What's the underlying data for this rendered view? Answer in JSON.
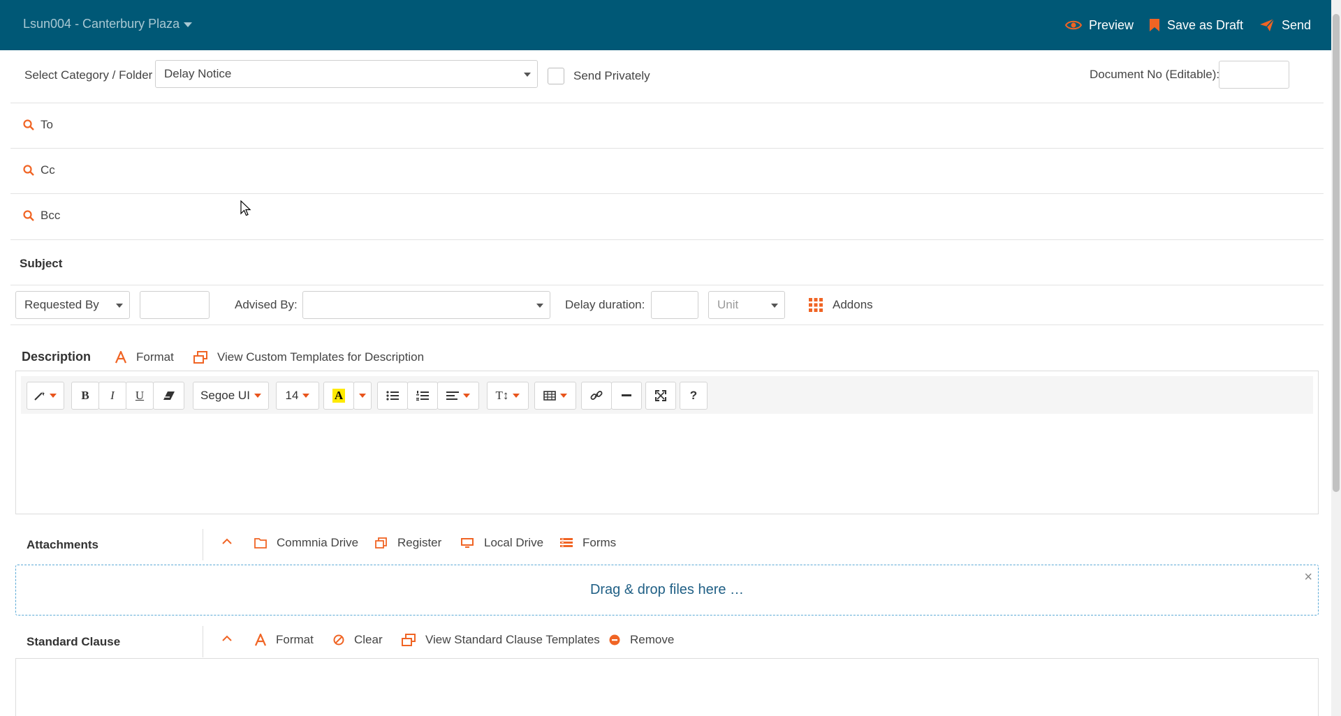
{
  "colors": {
    "header_bg": "#005876",
    "accent": "#f06424",
    "dropzone_text": "#1f5f85"
  },
  "header": {
    "project": "Lsun004 - Canterbury Plaza",
    "preview": "Preview",
    "save_draft": "Save as Draft",
    "send": "Send"
  },
  "form": {
    "category_label": "Select Category / Folder",
    "category_value": "Delay Notice",
    "send_privately": "Send Privately",
    "docno_label": "Document No (Editable):",
    "docno_value": "",
    "to": "To",
    "cc": "Cc",
    "bcc": "Bcc",
    "subject": "Subject",
    "requested_by": "Requested By",
    "advised_by_label": "Advised By:",
    "advised_by_value": "",
    "delay_label": "Delay duration:",
    "unit_placeholder": "Unit",
    "addons": "Addons"
  },
  "description": {
    "title": "Description",
    "format": "Format",
    "templates": "View Custom Templates for Description"
  },
  "toolbar": {
    "font": "Segoe UI",
    "size": "14",
    "bold": "B",
    "italic": "I",
    "underline": "U",
    "highlight": "A",
    "textsize": "T↕",
    "help": "?"
  },
  "attachments": {
    "title": "Attachments",
    "drive": "Commnia Drive",
    "register": "Register",
    "local": "Local Drive",
    "forms": "Forms",
    "drop": "Drag & drop files here …",
    "close": "×"
  },
  "clause": {
    "title": "Standard Clause",
    "format": "Format",
    "clear": "Clear",
    "templates": "View Standard Clause Templates",
    "remove": "Remove"
  }
}
